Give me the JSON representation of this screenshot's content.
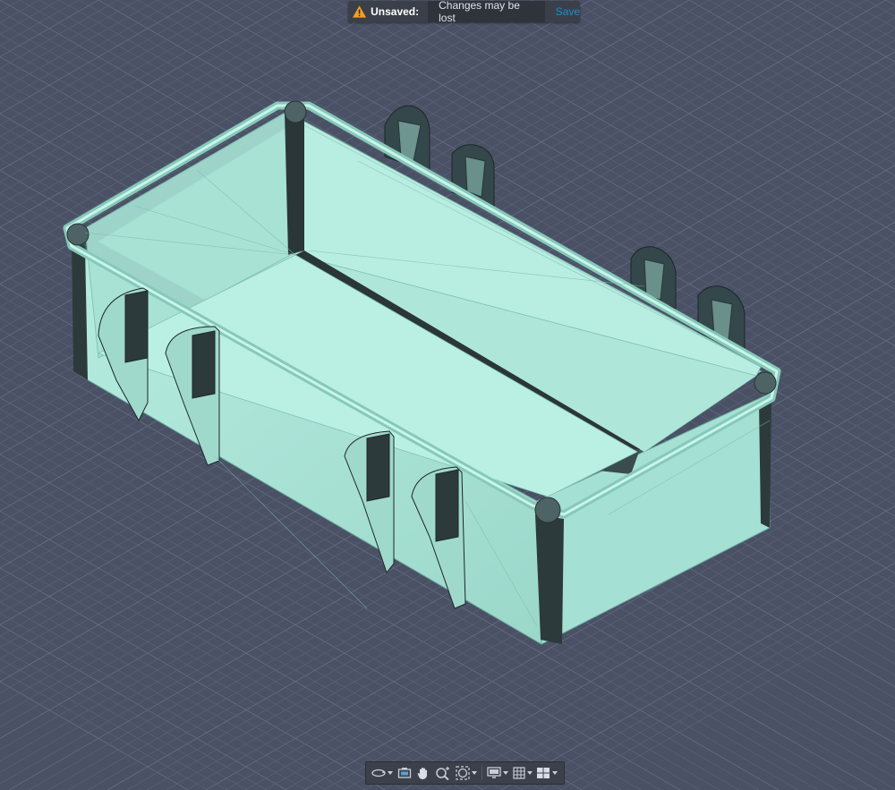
{
  "notice": {
    "title": "Unsaved:",
    "message": "Changes may be lost",
    "save_label": "Save"
  },
  "colors": {
    "background": "#4a5165",
    "grid_minor": "#5a6175",
    "grid_major": "#69708a",
    "model_light": "#a8e3d6",
    "model_mid": "#8ecfc1",
    "model_dark": "#2d3a3c",
    "accent_link": "#1e8ecf",
    "warning": "#f0a020"
  },
  "toolbar": {
    "tools": [
      {
        "icon": "orbit-icon",
        "has_menu": true
      },
      {
        "icon": "look-at-icon",
        "has_menu": false
      },
      {
        "icon": "pan-hand-icon",
        "has_menu": false
      },
      {
        "icon": "zoom-icon",
        "has_menu": false
      },
      {
        "icon": "fit-icon",
        "has_menu": true
      },
      {
        "icon": "display-settings-icon",
        "has_menu": true
      },
      {
        "icon": "grid-snap-icon",
        "has_menu": true
      },
      {
        "icon": "viewports-icon",
        "has_menu": true
      }
    ]
  }
}
